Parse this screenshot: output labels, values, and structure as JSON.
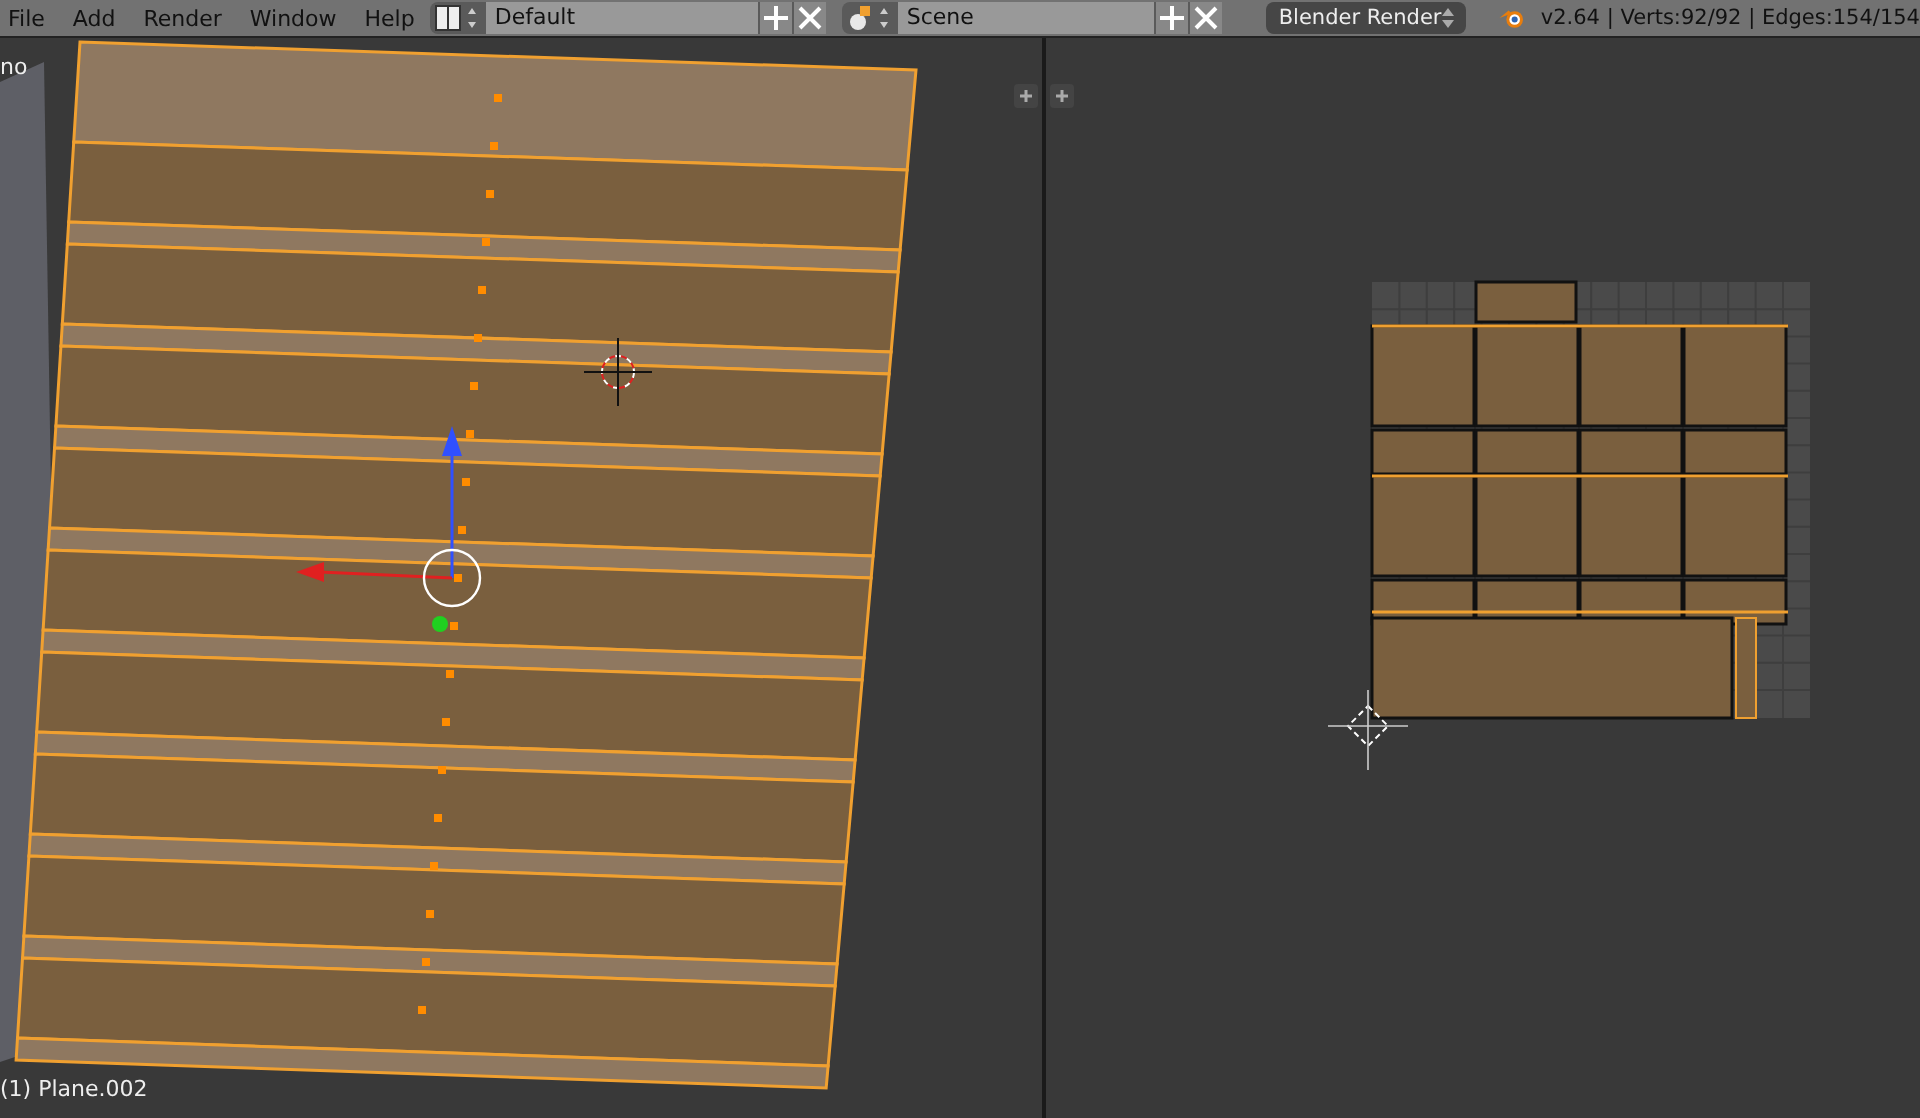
{
  "menu": [
    "File",
    "Add",
    "Render",
    "Window",
    "Help"
  ],
  "screen_layout": {
    "value": "Default"
  },
  "scene": {
    "value": "Scene"
  },
  "render_engine": {
    "value": "Blender Render"
  },
  "stats": "v2.64 | Verts:92/92 | Edges:154/154",
  "viewport": {
    "view_label": "no",
    "object_label": "(1) Plane.002"
  }
}
